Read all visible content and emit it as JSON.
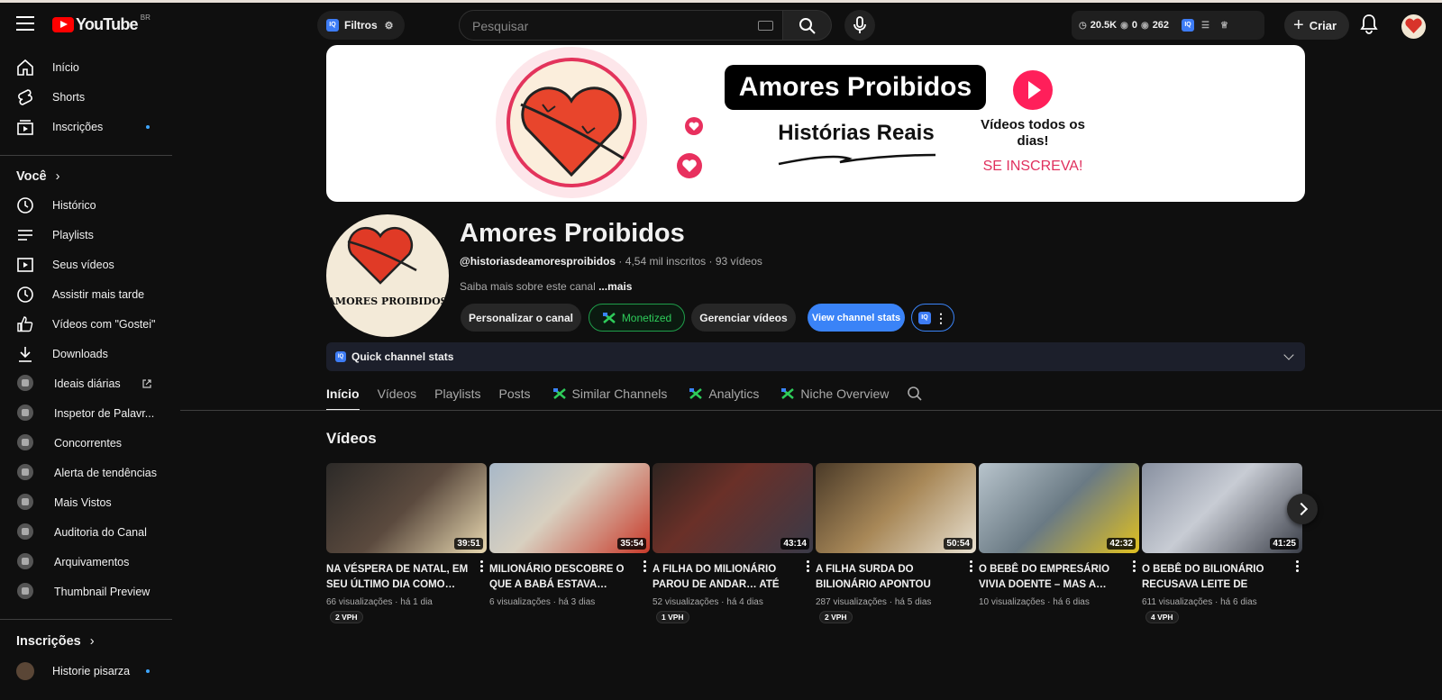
{
  "app": {
    "logo_text": "YouTube",
    "country_code": "BR"
  },
  "header": {
    "filters_label": "Filtros",
    "search_placeholder": "Pesquisar",
    "stats": {
      "views": "20.5K",
      "pending": "0",
      "watching": "262"
    },
    "create_label": "Criar"
  },
  "sidebar": {
    "main": [
      {
        "label": "Início",
        "icon": "home-icon"
      },
      {
        "label": "Shorts",
        "icon": "shorts-icon"
      },
      {
        "label": "Inscrições",
        "icon": "subscriptions-icon"
      }
    ],
    "you_title": "Você",
    "you_items": [
      {
        "label": "Histórico",
        "icon": "history-icon"
      },
      {
        "label": "Playlists",
        "icon": "playlists-icon"
      },
      {
        "label": "Seus vídeos",
        "icon": "your-videos-icon"
      },
      {
        "label": "Assistir mais tarde",
        "icon": "watch-later-icon"
      },
      {
        "label": "Vídeos com \"Gostei\"",
        "icon": "like-icon"
      },
      {
        "label": "Downloads",
        "icon": "download-icon"
      }
    ],
    "tools": [
      {
        "label": "Ideais diárias"
      },
      {
        "label": "Inspetor de Palavr..."
      },
      {
        "label": "Concorrentes"
      },
      {
        "label": "Alerta de tendências"
      },
      {
        "label": "Mais Vistos"
      },
      {
        "label": "Auditoria do Canal"
      },
      {
        "label": "Arquivamentos"
      },
      {
        "label": "Thumbnail Preview"
      }
    ],
    "subs_title": "Inscrições",
    "subs": [
      {
        "label": "Historie pisarza"
      }
    ]
  },
  "banner": {
    "title": "Amores Proibidos",
    "subtitle": "Histórias Reais",
    "daily": "Vídeos todos os dias!",
    "cta": "SE INSCREVA!",
    "heart_color": "#e8452c",
    "accent": "#ff1f5a"
  },
  "channel": {
    "name": "Amores Proibidos",
    "avatar_text": "AMORES PROIBIDOS",
    "handle": "@historiasdeamoresproibidos",
    "subscribers": "4,54 mil inscritos",
    "videos_count": "93 vídeos",
    "about": "Saiba mais sobre este canal",
    "about_more": "...mais",
    "buttons": {
      "customize": "Personalizar o canal",
      "monetized": "Monetized",
      "manage": "Gerenciar vídeos",
      "stats": "View channel stats"
    }
  },
  "quick_stats": {
    "label": "Quick channel stats"
  },
  "tabs": [
    {
      "label": "Início",
      "active": true
    },
    {
      "label": "Vídeos"
    },
    {
      "label": "Playlists"
    },
    {
      "label": "Posts"
    },
    {
      "label": "Similar Channels",
      "ext": true
    },
    {
      "label": "Analytics",
      "ext": true
    },
    {
      "label": "Niche Overview",
      "ext": true
    }
  ],
  "videos_section": {
    "title": "Vídeos",
    "items": [
      {
        "title": "NA VÉSPERA DE NATAL, EM SEU ÚLTIMO DIA COMO…",
        "duration": "39:51",
        "views": "66 visualizações",
        "age": "há 1 dia",
        "vph": "2 VPH",
        "color": "#3a3530"
      },
      {
        "title": "MILIONÁRIO DESCOBRE O QUE A BABÁ ESTAVA…",
        "duration": "35:54",
        "views": "6 visualizações",
        "age": "há 3 dias",
        "vph": "",
        "color": "#8c9aa8"
      },
      {
        "title": "A FILHA DO MILIONÁRIO PAROU DE ANDAR… ATÉ QU…",
        "duration": "43:14",
        "views": "52 visualizações",
        "age": "há 4 dias",
        "vph": "1 VPH",
        "color": "#3c2f2c"
      },
      {
        "title": "A FILHA SURDA DO BILIONÁRIO APONTOU PAR…",
        "duration": "50:54",
        "views": "287 visualizações",
        "age": "há 5 dias",
        "vph": "2 VPH",
        "color": "#6e5a3c"
      },
      {
        "title": "O BEBÊ DO EMPRESÁRIO VIVIA DOENTE – MAS A…",
        "duration": "42:32",
        "views": "10 visualizações",
        "age": "há 6 dias",
        "vph": "",
        "color": "#7d8a90"
      },
      {
        "title": "O BEBÊ DO BILIONÁRIO RECUSAVA LEITE DE TODA…",
        "duration": "41:25",
        "views": "611 visualizações",
        "age": "há 6 dias",
        "vph": "4 VPH",
        "color": "#6f7880"
      }
    ]
  }
}
